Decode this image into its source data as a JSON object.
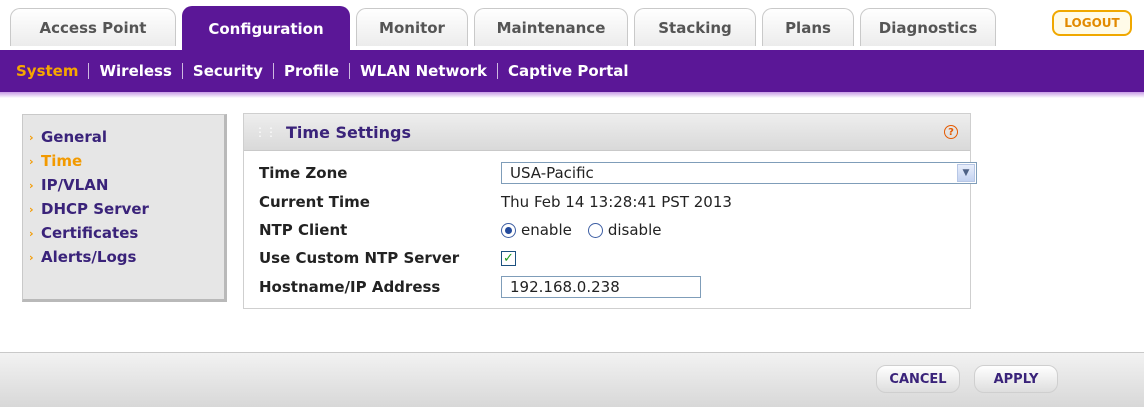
{
  "tabs": [
    {
      "label": "Access Point"
    },
    {
      "label": "Configuration"
    },
    {
      "label": "Monitor"
    },
    {
      "label": "Maintenance"
    },
    {
      "label": "Stacking"
    },
    {
      "label": "Plans"
    },
    {
      "label": "Diagnostics"
    }
  ],
  "logout_label": "LOGOUT",
  "subnav": [
    {
      "label": "System"
    },
    {
      "label": "Wireless"
    },
    {
      "label": "Security"
    },
    {
      "label": "Profile"
    },
    {
      "label": "WLAN Network"
    },
    {
      "label": "Captive Portal"
    }
  ],
  "leftmenu": [
    {
      "label": "General"
    },
    {
      "label": "Time"
    },
    {
      "label": "IP/VLAN"
    },
    {
      "label": "DHCP Server"
    },
    {
      "label": "Certificates"
    },
    {
      "label": "Alerts/Logs"
    }
  ],
  "panel": {
    "title": "Time Settings",
    "help_glyph": "?",
    "time_zone_label": "Time Zone",
    "time_zone_value": "USA-Pacific",
    "current_time_label": "Current Time",
    "current_time_value": "Thu Feb 14 13:28:41 PST 2013",
    "ntp_client_label": "NTP Client",
    "ntp_enable_label": "enable",
    "ntp_disable_label": "disable",
    "ntp_selected": "enable",
    "custom_ntp_label": "Use Custom NTP Server",
    "custom_ntp_checked": true,
    "hostname_label": "Hostname/IP Address",
    "hostname_value": "192.168.0.238"
  },
  "buttons": {
    "cancel": "CANCEL",
    "apply": "APPLY"
  },
  "colors": {
    "brand_purple": "#5b1797",
    "accent_orange": "#f29a00"
  }
}
